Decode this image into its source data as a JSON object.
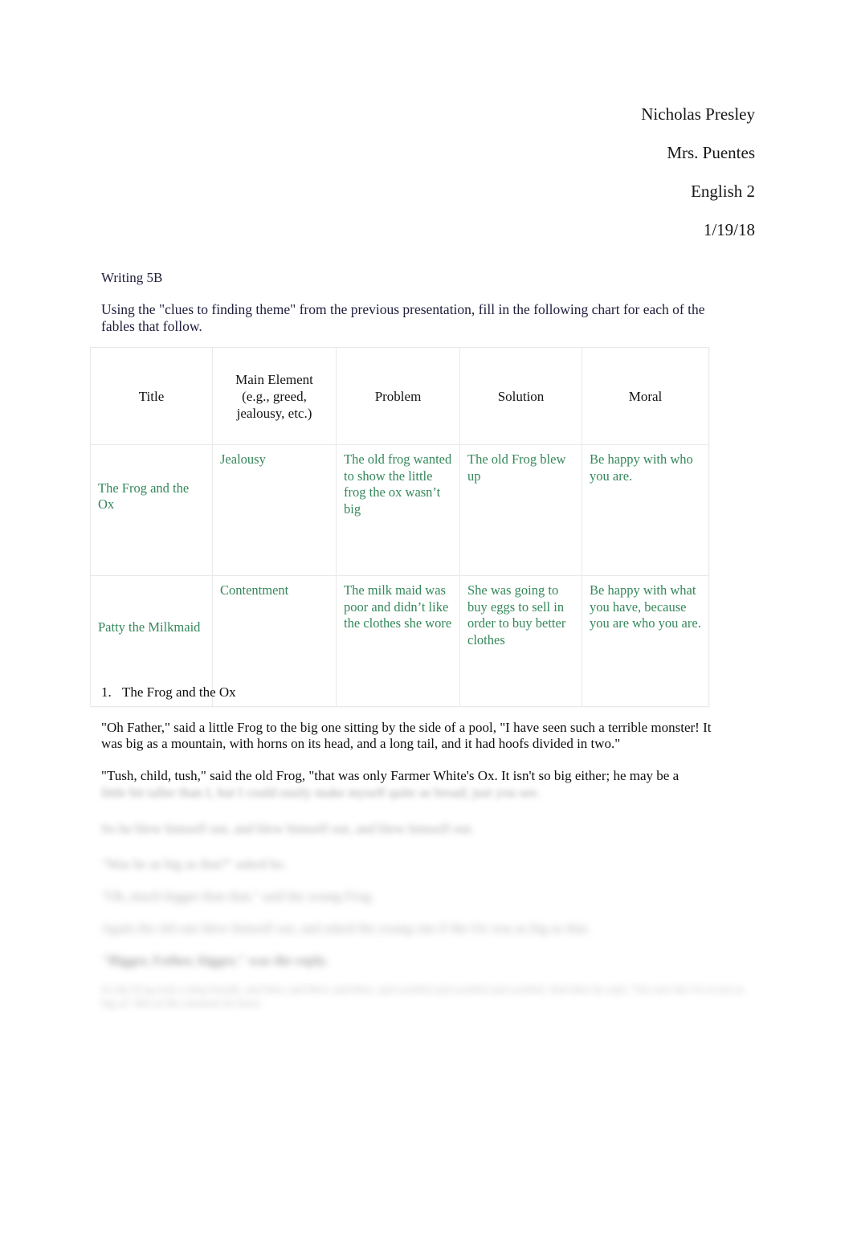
{
  "document": {
    "background_color": "#ffffff",
    "body_text_color": "#1e1e3c",
    "answer_text_color": "#35885a",
    "table_border_color": "#e9e9e9"
  },
  "header": {
    "student_name": "Nicholas Presley",
    "teacher": "Mrs. Puentes",
    "course": "English 2",
    "date": "1/19/18"
  },
  "intro": {
    "assignment": "Writing 5B",
    "instructions": "Using the \"clues to finding theme\" from the previous presentation, fill in the following chart for each of the fables that follow."
  },
  "table": {
    "columns": [
      "Title",
      "Main Element (e.g., greed, jealousy, etc.)",
      "Problem",
      "Solution",
      "Moral"
    ],
    "column_headers": {
      "title": "Title",
      "main_element_line1": "Main Element",
      "main_element_line2": "(e.g., greed,",
      "main_element_line3": "jealousy, etc.)",
      "problem": "Problem",
      "solution": "Solution",
      "moral": "Moral"
    },
    "rows": [
      {
        "title": "The Frog and the Ox",
        "main_element": "Jealousy",
        "problem": "The old frog wanted to show the little frog the ox wasn’t big",
        "solution": "The old Frog blew up",
        "moral": "Be happy with who you are."
      },
      {
        "title": "Patty the Milkmaid",
        "main_element": "Contentment",
        "problem": "The milk maid was poor and didn’t like the clothes she wore",
        "solution": "She was going to buy eggs to sell in order to buy better clothes",
        "moral": "Be happy with what you have, because you are who you are."
      }
    ]
  },
  "fable": {
    "list_number": "1.",
    "list_title": "The Frog and the Ox",
    "paragraph_1": "\"Oh Father,\" said a little Frog to the big one sitting by the side of a pool, \"I have seen such a terrible monster! It was big as a mountain, with horns on its head, and a long tail, and it had hoofs divided in two.\"",
    "paragraph_2": "\"Tush, child, tush,\" said the old Frog, \"that was only Farmer White's Ox. It isn't so big either; he may be a"
  },
  "obscured": {
    "note": "remaining fable text is blurred and illegible in the screenshot",
    "line_1": "little bit taller than I, but I could easily make myself quite as broad; just you see.",
    "line_2": "So he blew himself out, and blew himself out, and blew himself out.",
    "line_3": "\"Was he as big as that?\" asked he.",
    "line_4": "\"Oh, much bigger than that,\" said the young Frog.",
    "line_5": "Again the old one blew himself out, and asked the young one if the Ox was as big as that.",
    "line_6": "\"Bigger, Father, bigger,\" was the reply.",
    "line_7": "So the Frog took a deep breath, and blew and blew and blew, and swelled and swelled and swelled. And then he said, \"I'm sure the Ox is not as big as\" But at this moment he burst."
  }
}
